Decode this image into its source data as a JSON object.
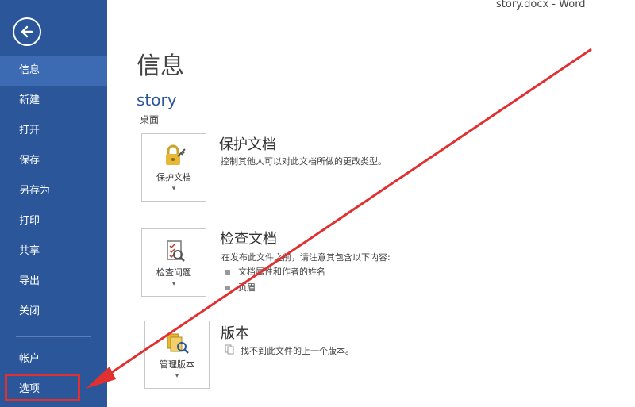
{
  "window": {
    "title": "story.docx - Word"
  },
  "sidebar": {
    "items": [
      {
        "label": "信息"
      },
      {
        "label": "新建"
      },
      {
        "label": "打开"
      },
      {
        "label": "保存"
      },
      {
        "label": "另存为"
      },
      {
        "label": "打印"
      },
      {
        "label": "共享"
      },
      {
        "label": "导出"
      },
      {
        "label": "关闭"
      },
      {
        "label": "帐户"
      },
      {
        "label": "选项"
      }
    ],
    "selected": "信息"
  },
  "main": {
    "title": "信息",
    "doc_name": "story",
    "doc_location": "桌面",
    "sections": [
      {
        "button_label": "保护文档",
        "title": "保护文档",
        "description": "控制其他人可以对此文档所做的更改类型。"
      },
      {
        "button_label": "检查问题",
        "title": "检查文档",
        "description": "在发布此文件之前，请注意其包含以下内容:",
        "bullets": [
          "文档属性和作者的姓名",
          "页眉"
        ]
      },
      {
        "button_label": "管理版本",
        "title": "版本",
        "description": "找不到此文件的上一个版本。"
      }
    ]
  },
  "annotation": {
    "color": "#e03030"
  },
  "colors": {
    "sidebar": "#2b579a",
    "sidebar_selected": "#3c6bb3",
    "accent": "#2b579a"
  }
}
